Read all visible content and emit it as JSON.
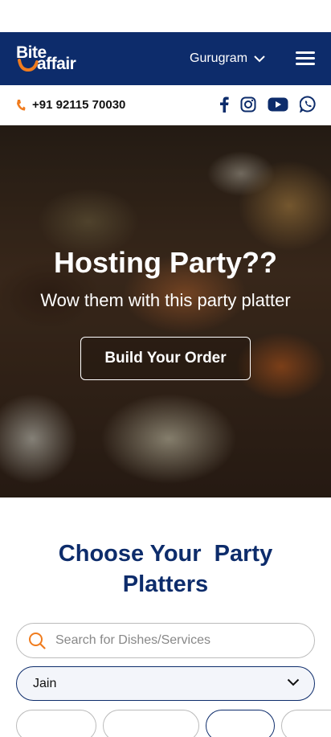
{
  "header": {
    "logo_top": "Bite",
    "logo_bottom": "affair",
    "location": "Gurugram"
  },
  "contact": {
    "phone": "+91 92115 70030",
    "socials": [
      "facebook-icon",
      "instagram-icon",
      "youtube-icon",
      "whatsapp-icon"
    ]
  },
  "hero": {
    "title": "Hosting Party??",
    "subtitle": "Wow them with this party platter",
    "cta": "Build Your Order"
  },
  "section": {
    "title_line1": "Choose Your  Party",
    "title_line2": "Platters"
  },
  "search": {
    "placeholder": "Search for Dishes/Services"
  },
  "filter": {
    "selected": "Jain"
  },
  "colors": {
    "navy": "#0d2c6b",
    "accent": "#f07c1e"
  }
}
